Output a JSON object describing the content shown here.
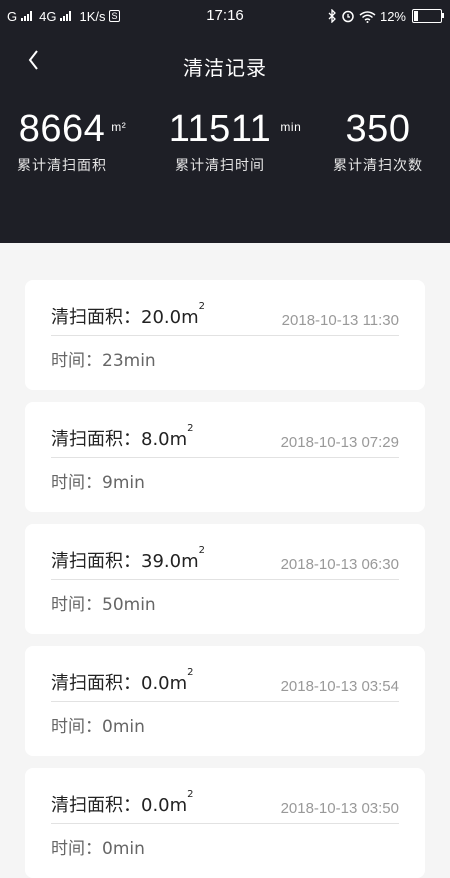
{
  "status_bar": {
    "left_text": "G",
    "network": "4G",
    "speed": "1K/s",
    "s_badge": "S",
    "time": "17:16",
    "battery": "12%"
  },
  "nav": {
    "title": "清洁记录"
  },
  "stats": [
    {
      "value": "8664",
      "unit": "m²",
      "label": "累计清扫面积"
    },
    {
      "value": "11511",
      "unit": "min",
      "label": "累计清扫时间"
    },
    {
      "value": "350",
      "unit": "",
      "label": "累计清扫次数"
    }
  ],
  "records": [
    {
      "area_label": "清扫面积：",
      "area_value": "20.0m",
      "area_sup": "2",
      "date": "2018-10-13 11:30",
      "time_label": "时间：",
      "time_value": "23min"
    },
    {
      "area_label": "清扫面积：",
      "area_value": "8.0m",
      "area_sup": "2",
      "date": "2018-10-13 07:29",
      "time_label": "时间：",
      "time_value": "9min"
    },
    {
      "area_label": "清扫面积：",
      "area_value": "39.0m",
      "area_sup": "2",
      "date": "2018-10-13 06:30",
      "time_label": "时间：",
      "time_value": "50min"
    },
    {
      "area_label": "清扫面积：",
      "area_value": "0.0m",
      "area_sup": "2",
      "date": "2018-10-13 03:54",
      "time_label": "时间：",
      "time_value": "0min"
    },
    {
      "area_label": "清扫面积：",
      "area_value": "0.0m",
      "area_sup": "2",
      "date": "2018-10-13 03:50",
      "time_label": "时间：",
      "time_value": "0min"
    }
  ]
}
